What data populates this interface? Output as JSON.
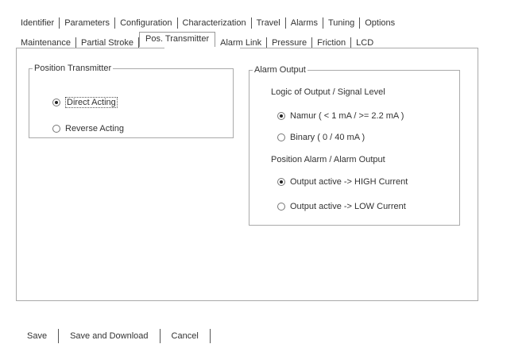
{
  "tabs_row1": [
    "Identifier",
    "Parameters",
    "Configuration",
    "Characterization",
    "Travel",
    "Alarms",
    "Tuning",
    "Options"
  ],
  "tabs_row2": [
    "Maintenance",
    "Partial Stroke",
    "Pos. Transmitter",
    "Alarm Link",
    "Pressure",
    "Friction",
    "LCD"
  ],
  "active_tab": "Pos. Transmitter",
  "position_transmitter": {
    "legend": "Position Transmitter",
    "options": [
      {
        "label": "Direct Acting",
        "checked": true
      },
      {
        "label": "Reverse Acting",
        "checked": false
      }
    ]
  },
  "alarm_output": {
    "legend": "Alarm Output",
    "logic_caption": "Logic of Output / Signal Level",
    "logic_options": [
      {
        "label": "Namur ( < 1 mA / >= 2.2 mA )",
        "checked": true
      },
      {
        "label": "Binary ( 0 / 40 mA )",
        "checked": false
      }
    ],
    "position_caption": "Position Alarm / Alarm Output",
    "position_options": [
      {
        "label": "Output active -> HIGH Current",
        "checked": true
      },
      {
        "label": "Output active -> LOW Current",
        "checked": false
      }
    ]
  },
  "buttons": {
    "save": "Save",
    "save_download": "Save and Download",
    "cancel": "Cancel"
  }
}
